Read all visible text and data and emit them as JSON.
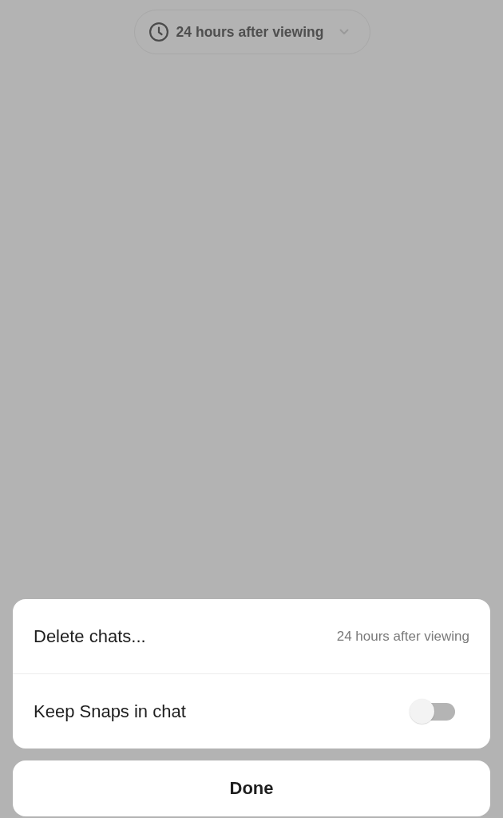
{
  "timer_pill": {
    "label": "24 hours after viewing"
  },
  "settings": [
    {
      "kind": "value",
      "label": "Delete chats...",
      "value": "24 hours after viewing"
    },
    {
      "kind": "toggle",
      "label": "Keep Snaps in chat",
      "on": false
    }
  ],
  "done_button": {
    "label": "Done"
  }
}
